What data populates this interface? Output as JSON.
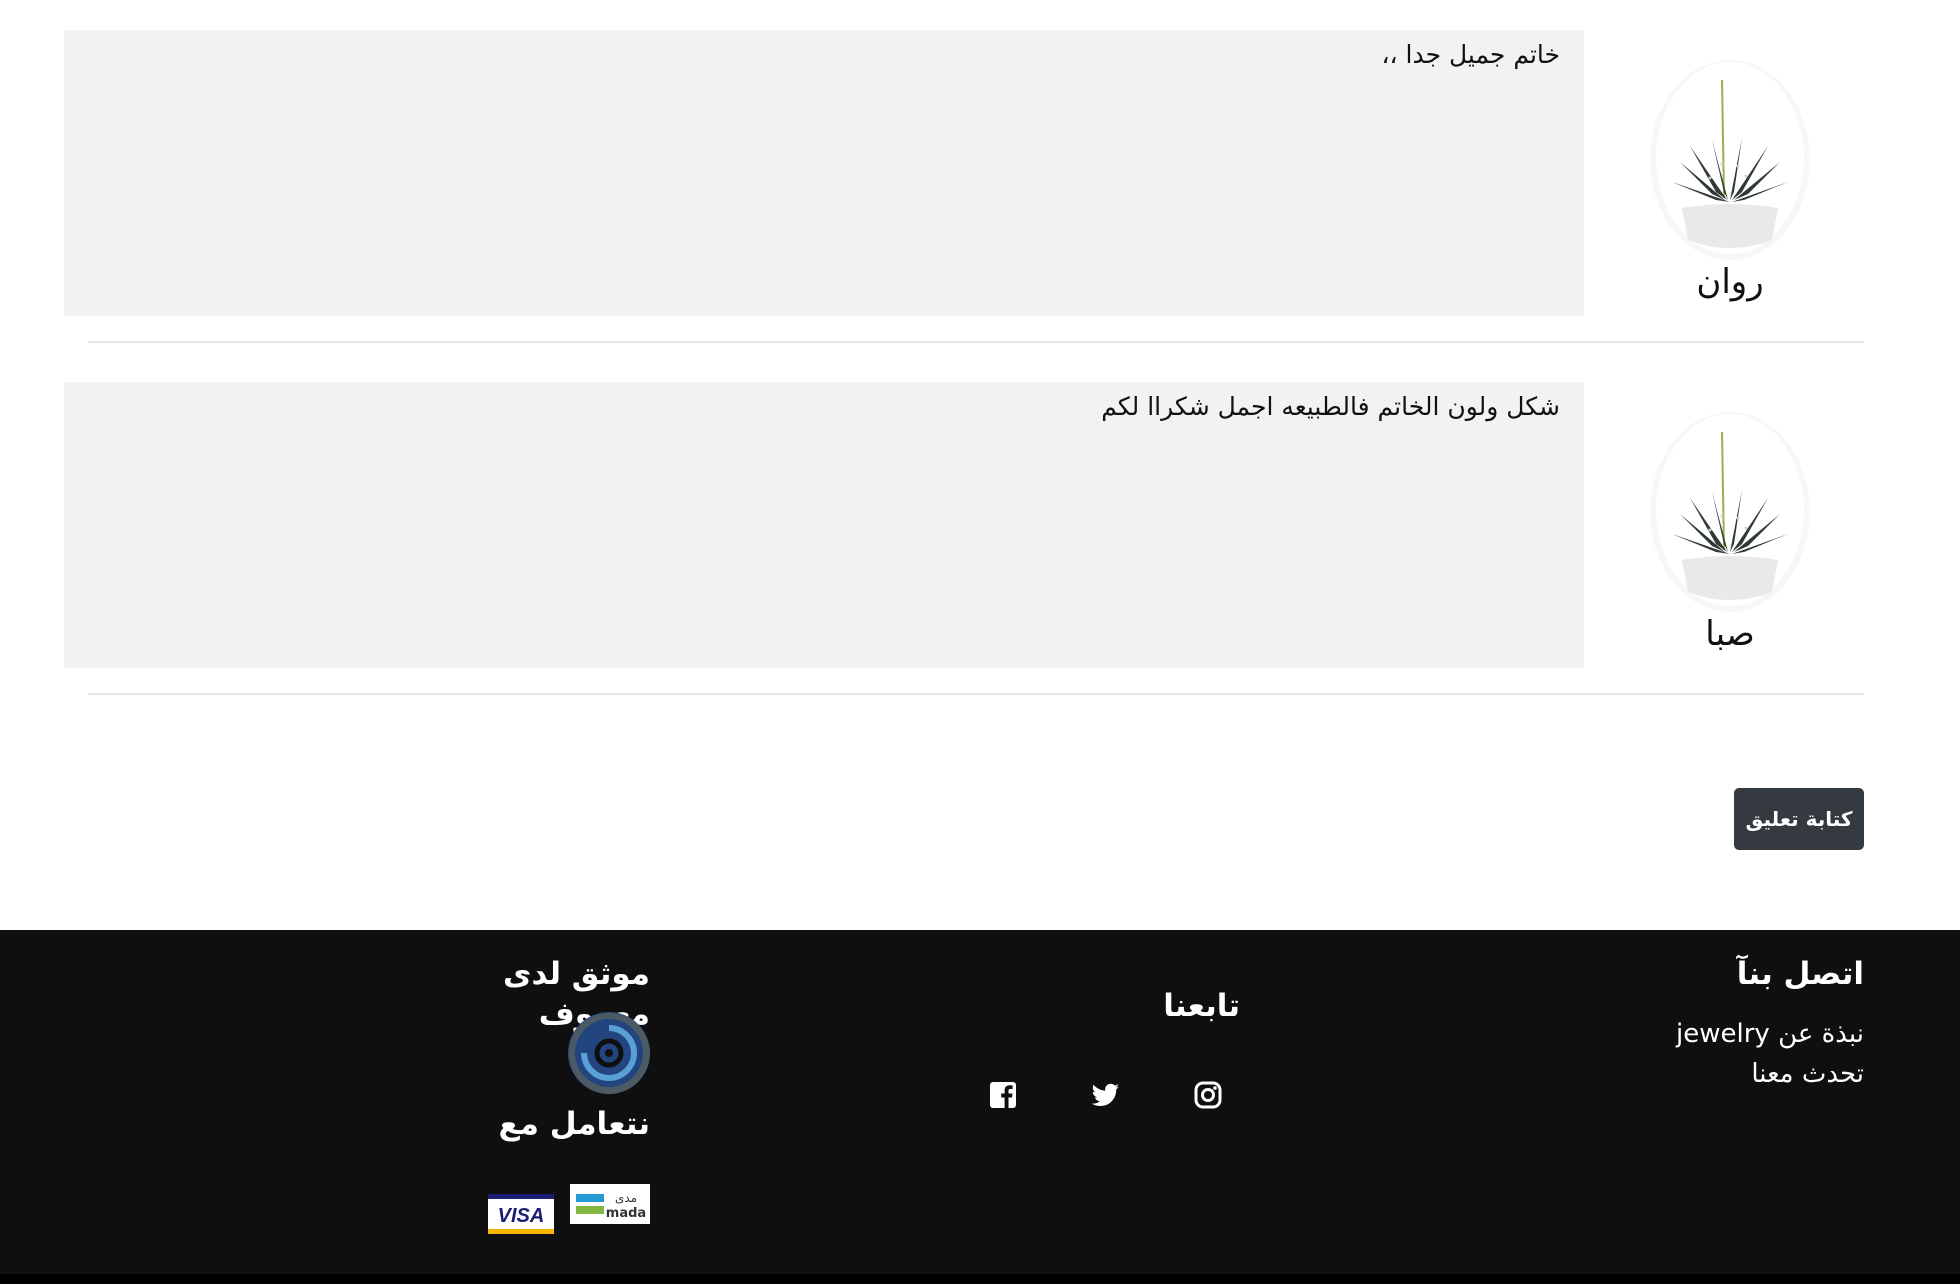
{
  "reviews": [
    {
      "author": "روان",
      "text": "خاتم جميل جدا ،،",
      "avatar_icon": "plant-avatar-icon"
    },
    {
      "author": "صبا",
      "text": "شكل ولون الخاتم فالطبيعه اجمل شكراا لكم",
      "avatar_icon": "plant-avatar-icon"
    }
  ],
  "write_review_label": "كتابة تعليق",
  "footer": {
    "contact": {
      "title": "اتصل بنآ",
      "links": [
        "نبذة عن jewelry",
        "تحدث معنا"
      ]
    },
    "follow": {
      "title": "تابعنا",
      "icons": [
        "instagram-icon",
        "twitter-icon",
        "facebook-icon"
      ]
    },
    "trusted": {
      "title": "موثق لدى معروف",
      "logo_icon": "maroof-logo-icon",
      "deal_title": "نتعامل مع",
      "payments": [
        "mada",
        "VISA"
      ],
      "mada_arabic": "مدى"
    }
  },
  "colors": {
    "footer_bg": "#0f0f0f",
    "review_bg": "#f2f2f2",
    "button_bg": "#343a40"
  }
}
